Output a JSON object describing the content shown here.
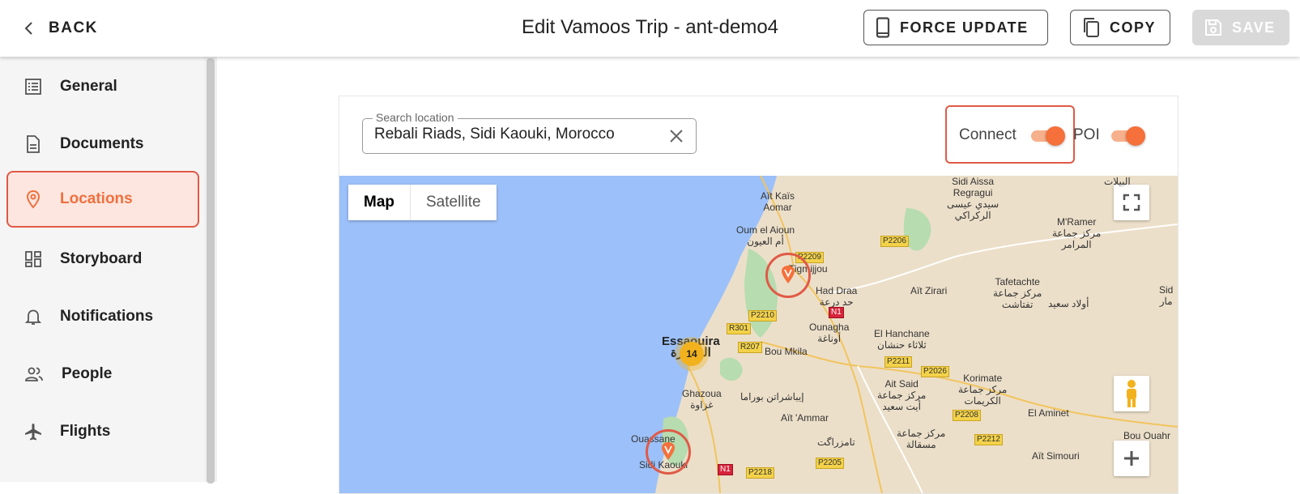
{
  "header": {
    "back_label": "BACK",
    "title": "Edit Vamoos Trip - ant-demo4",
    "force_update_label": "FORCE UPDATE",
    "copy_label": "COPY",
    "save_label": "SAVE"
  },
  "sidebar": {
    "items": [
      {
        "label": "General",
        "icon": "list-icon",
        "active": false
      },
      {
        "label": "Documents",
        "icon": "document-icon",
        "active": false
      },
      {
        "label": "Locations",
        "icon": "location-pin-icon",
        "active": true
      },
      {
        "label": "Storyboard",
        "icon": "dashboard-icon",
        "active": false
      },
      {
        "label": "Notifications",
        "icon": "bell-icon",
        "active": false
      },
      {
        "label": "People",
        "icon": "people-icon",
        "active": false
      },
      {
        "label": "Flights",
        "icon": "airplane-icon",
        "active": false
      }
    ]
  },
  "locations": {
    "search": {
      "label": "Search location",
      "value": "Rebali Riads, Sidi Kaouki, Morocco"
    },
    "toggles": {
      "connect_label": "Connect",
      "connect_on": true,
      "poi_label": "POI",
      "poi_on": true
    }
  },
  "map": {
    "type_map_label": "Map",
    "type_satellite_label": "Satellite",
    "cluster_count": "14",
    "places": {
      "ait_kais": "Aït Kaïs\nAomar",
      "oum_el_aioun": "Oum el Aioun\nأم العيون",
      "tigmijjou": "Tigmijjou",
      "had_draa": "Had Draa\nحد درعة",
      "essaouira": "Essaouira\nالصويرة",
      "ounagha": "Ounagha\nأوناغة",
      "bou_mkila": "Bou Mkila",
      "el_hanchane": "El Hanchane\nثلاثاء حنشان",
      "ghazoua": "Ghazoua\nغزاوة",
      "bourama": "إيباشراتن بوراما",
      "ait_ammar": "Aït 'Ammar",
      "ouassane": "Ouassane",
      "sidi_kaouki": "Sidi Kaouki",
      "tamzargat": "تامزراگت",
      "ait_said": "Ait Said\nمركز جماعة\nأيت سعيد",
      "korimate": "Korimate\nمركز جماعة\nالكريمات",
      "masala": "مركز جماعة\nمسقالة",
      "el_aminet": "El Aminet",
      "ait_zirari": "Aït Zirari",
      "tafetachte": "Tafetachte\nمركز جماعة\nتفتاشت",
      "oulad_said": "أولاد سعيد",
      "sidi_aissa": "Sidi Aissa\nRegragui\nسيدي عيسى\nالركراكي",
      "mramer": "M'Ramer\nمركز جماعة\nالمرامر",
      "ait_simouri": "Aït Simouri",
      "bou_ouahr": "Bou Ouahr",
      "top_edge": "البيلات",
      "right_edge": "Sid\nمار"
    },
    "roads": {
      "p2206": "P2206",
      "p2209": "P2209",
      "p2210": "P2210",
      "r301": "R301",
      "r207": "R207",
      "p2211": "P2211",
      "p2026": "P2026",
      "p2208": "P2208",
      "p2212": "P2212",
      "p2205": "P2205",
      "p2218": "P2218",
      "n1a": "N1",
      "n1b": "N1"
    }
  },
  "colors": {
    "accent": "#f0703d",
    "active_border": "#e05a47",
    "active_bg": "#fde6e0",
    "water": "#9cc0f9",
    "land": "#ecdfc9",
    "park": "#b7dcb0"
  }
}
